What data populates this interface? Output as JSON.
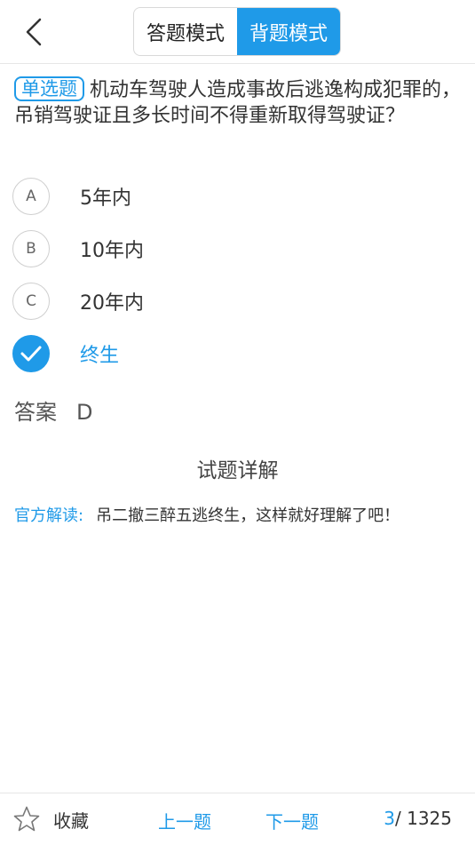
{
  "header": {
    "back_icon": "chevron-left-icon",
    "modes": [
      {
        "label": "答题模式",
        "active": false
      },
      {
        "label": "背题模式",
        "active": true
      }
    ]
  },
  "question": {
    "type_badge": "单选题",
    "text": "机动车驾驶人造成事故后逃逸构成犯罪的，吊销驾驶证且多长时间不得重新取得驾驶证？"
  },
  "options": [
    {
      "letter": "A",
      "text": "5年内",
      "selected": false
    },
    {
      "letter": "B",
      "text": "10年内",
      "selected": false
    },
    {
      "letter": "C",
      "text": "20年内",
      "selected": false
    },
    {
      "letter": "D",
      "text": "终生",
      "selected": true
    }
  ],
  "answer": {
    "label": "答案",
    "value": "D"
  },
  "detail": {
    "title": "试题详解",
    "label": "官方解读:",
    "text": "吊二撤三醉五逃终生，这样就好理解了吧！"
  },
  "footer": {
    "favorite_label": "收藏",
    "prev_label": "上一题",
    "next_label": "下一题",
    "current": "3",
    "separator": "/ ",
    "total": "1325"
  },
  "colors": {
    "accent": "#1f9ae8"
  }
}
